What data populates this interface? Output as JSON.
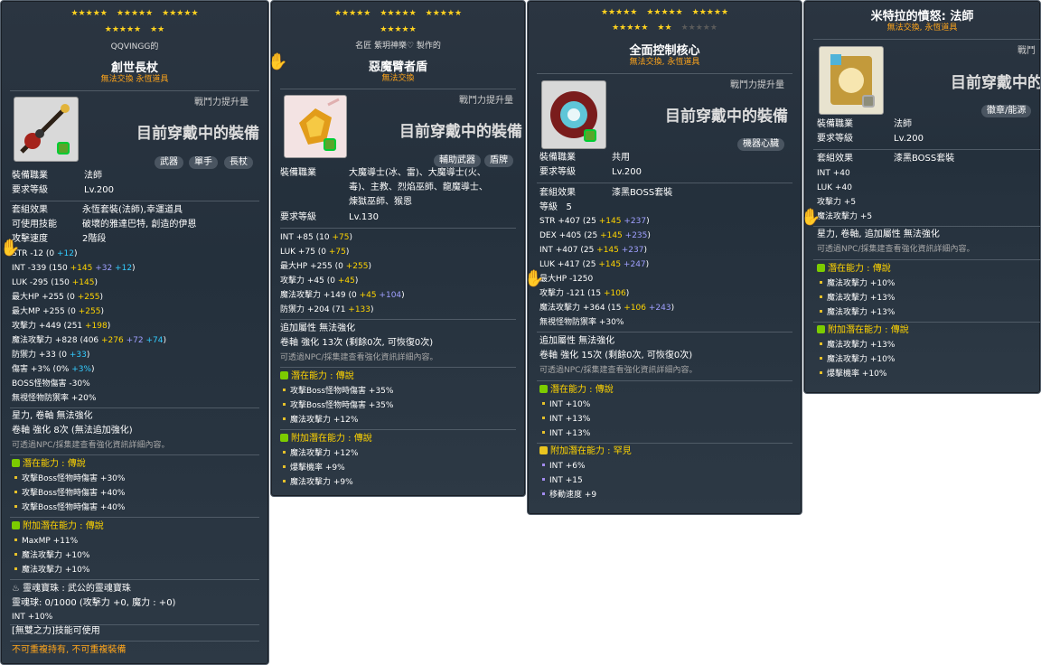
{
  "panel1": {
    "stars_row1": [
      "★★★★★",
      "★★★★★",
      "★★★★★"
    ],
    "stars_row2": [
      "★★★★★",
      "★★"
    ],
    "owner": "QQVINGG的",
    "title": "創世長杖",
    "subtitle": "無法交換  永恆道具",
    "boost_label": "戰鬥力提升量",
    "current_equipped": "目前穿戴中的裝備",
    "tags": [
      "武器",
      "單手",
      "長杖"
    ],
    "job_label": "裝備職業",
    "job_value": "法師",
    "req_level_label": "要求等級",
    "req_level_value": "Lv.200",
    "set_label": "套組效果",
    "set_value": "永恆套裝(法師),幸運道具",
    "skill_label": "可使用技能",
    "skill_value": "破壞的雅達巴特, 創造的伊恩",
    "speed_label": "攻擊速度",
    "speed_value": "2階段",
    "stats": [
      {
        "name": "STR",
        "base": " -12 (",
        "v1": "0 ",
        "v2": "+12",
        "close": ")"
      },
      {
        "name": "INT",
        "base": " -339 (150 ",
        "v1": "+145",
        "v2": " +32 ",
        "v3": "+12",
        "close": ")"
      },
      {
        "name": "LUK",
        "base": " -295 (150 ",
        "v1": "+145",
        "close": ")"
      },
      {
        "name": "最大HP",
        "base": " +255 (0 ",
        "v1": "+255",
        "close": ")"
      },
      {
        "name": "最大MP",
        "base": " +255 (0 ",
        "v1": "+255",
        "close": ")"
      },
      {
        "name": "攻擊力",
        "base": " +449 (251 ",
        "v1": "+198",
        "close": ")"
      },
      {
        "name": "魔法攻擊力",
        "base": " +828 (406 ",
        "v1": "+276",
        "v2": " +72 ",
        "v3": "+74",
        "close": ")"
      },
      {
        "name": "防禦力",
        "base": " +33 (0 ",
        "v1": "+33",
        "close": ")"
      },
      {
        "name": "傷害",
        "base": " +3% (0% ",
        "v1": "+3%",
        "close": ")"
      },
      {
        "name": "BOSS怪物傷害",
        "base": " -30%"
      },
      {
        "name": "無視怪物防禦率",
        "base": " +20%"
      }
    ],
    "star_scroll": "星力, 卷軸 無法強化",
    "upgrade": "卷軸 強化 8次 (無法追加強化)",
    "npc_note": "可透過NPC/採集建查看強化資訊詳細內容。",
    "potential_title": "潛在能力 : 傳說",
    "potential": [
      "攻擊Boss怪物時傷害 +30%",
      "攻擊Boss怪物時傷害 +40%",
      "攻擊Boss怪物時傷害 +40%"
    ],
    "add_potential_title": "附加潛在能力 : 傳說",
    "add_potential": [
      "MaxMP +11%",
      "魔法攻擊力 +10%",
      "魔法攻擊力 +10%"
    ],
    "soul_title": "靈魂寶珠 : 武公的靈魂寶珠",
    "soul_value": "靈魂球: 0/1000 (攻擊力 +0, 魔力 : +0)",
    "soul_int": "INT +10%",
    "skill_note": "[無雙之力]技能可使用",
    "bottom_note": "不可重複持有, 不可重複裝備"
  },
  "panel2": {
    "stars_row1": [
      "★★★★★",
      "★★★★★",
      "★★★★★"
    ],
    "stars_row2": [
      "★★★★★"
    ],
    "maker": "名匠 紫玥神樂♡ 製作的",
    "title": "惡魔臂者盾",
    "subtitle": "無法交換",
    "boost_label": "戰鬥力提升量",
    "current_equipped": "目前穿戴中的裝備",
    "tags": [
      "輔助武器",
      "盾牌"
    ],
    "job_label": "裝備職業",
    "job_value": [
      "大魔導士(冰、雷)、大魔導士(火、",
      "毒)、主教、烈焰巫師、龍魔導士、",
      "煉獄巫師、猴恩"
    ],
    "req_level_label": "要求等級",
    "req_level_value": "Lv.130",
    "stats": [
      {
        "name": "INT",
        "base": " +85 (10 ",
        "v1": "+75",
        "close": ")"
      },
      {
        "name": "LUK",
        "base": " +75 (0 ",
        "v1": "+75",
        "close": ")"
      },
      {
        "name": "最大HP",
        "base": " +255 (0 ",
        "v1": "+255",
        "close": ")"
      },
      {
        "name": "攻擊力",
        "base": " +45 (0 ",
        "v1": "+45",
        "close": ")"
      },
      {
        "name": "魔法攻擊力",
        "base": " +149 (0 ",
        "v1": "+45",
        "v2": " +104",
        "close": ")"
      },
      {
        "name": "防禦力",
        "base": " +204 (71 ",
        "v1": "+133",
        "close": ")"
      }
    ],
    "add_attr": "追加屬性 無法強化",
    "upgrade": "卷軸 強化 13次 (剩餘0次, 可恢復0次)",
    "npc_note": "可透過NPC/採集建查看強化資訊詳細內容。",
    "potential_title": "潛在能力 : 傳說",
    "potential": [
      "攻擊Boss怪物時傷害 +35%",
      "攻擊Boss怪物時傷害 +35%",
      "魔法攻擊力 +12%"
    ],
    "add_potential_title": "附加潛在能力 : 傳說",
    "add_potential": [
      "魔法攻擊力 +12%",
      "爆擊機率 +9%",
      "魔法攻擊力 +9%"
    ]
  },
  "panel3": {
    "stars_row1": [
      "★★★★★",
      "★★★★★",
      "★★★★★"
    ],
    "stars_row2": [
      "★★★★★",
      "★★",
      "★★★★★"
    ],
    "title": "全面控制核心",
    "subtitle": "無法交換, 永恆道具",
    "boost_label": "戰鬥力提升量",
    "current_equipped": "目前穿戴中的裝備",
    "tags": [
      "機器心臟"
    ],
    "job_label": "裝備職業",
    "job_value": "共用",
    "req_level_label": "要求等級",
    "req_level_value": "Lv.200",
    "set_label": "套組效果",
    "set_value": "漆黑BOSS套裝",
    "level_label": "等級",
    "level_value": "5",
    "stats": [
      {
        "name": "STR",
        "base": " +407 (25 ",
        "v1": "+145",
        "v2": " +237",
        "close": ")"
      },
      {
        "name": "DEX",
        "base": " +405 (25 ",
        "v1": "+145",
        "v2": " +235",
        "close": ")"
      },
      {
        "name": "INT",
        "base": " +407 (25 ",
        "v1": "+145",
        "v2": " +237",
        "close": ")"
      },
      {
        "name": "LUK",
        "base": " +417 (25 ",
        "v1": "+145",
        "v2": " +247",
        "close": ")"
      },
      {
        "name": "最大HP",
        "base": " -1250"
      },
      {
        "name": "攻擊力",
        "base": " -121 (15 ",
        "v1": "+106",
        "close": ")"
      },
      {
        "name": "魔法攻擊力",
        "base": " +364 (15 ",
        "v1": "+106",
        "v2": " +243",
        "close": ")"
      },
      {
        "name": "無視怪物防禦率",
        "base": " +30%"
      }
    ],
    "add_attr": "追加屬性 無法強化",
    "upgrade": "卷軸 強化 15次 (剩餘0次, 可恢復0次)",
    "npc_note": "可透過NPC/採集建查看強化資訊詳細內容。",
    "potential_title": "潛在能力 : 傳說",
    "potential": [
      "INT +10%",
      "INT +13%",
      "INT +13%"
    ],
    "add_potential_title": "附加潛在能力 : 罕見",
    "add_potential": [
      "INT +6%",
      "INT +15",
      "移動速度 +9"
    ]
  },
  "panel4": {
    "title": "米特拉的憤怒: 法師",
    "subtitle": "無法交換, 永恆道具",
    "boost_label": "戰鬥",
    "current_equipped": "目前穿戴中的",
    "tags": [
      "徽章/能源"
    ],
    "job_label": "裝備職業",
    "job_value": "法師",
    "req_level_label": "要求等級",
    "req_level_value": "Lv.200",
    "set_label": "套組效果",
    "set_value": "漆黑BOSS套裝",
    "stats": [
      {
        "name": "INT",
        "base": " +40"
      },
      {
        "name": "LUK",
        "base": " +40"
      },
      {
        "name": "攻擊力",
        "base": " +5"
      },
      {
        "name": "魔法攻擊力",
        "base": " +5"
      }
    ],
    "star_scroll": "星力, 卷軸, 追加屬性 無法強化",
    "npc_note": "可透過NPC/採集建查看強化資訊詳細內容。",
    "potential_title": "潛在能力 : 傳說",
    "potential": [
      "魔法攻擊力 +10%",
      "魔法攻擊力 +13%",
      "魔法攻擊力 +13%"
    ],
    "add_potential_title": "附加潛在能力 : 傳說",
    "add_potential": [
      "魔法攻擊力 +13%",
      "魔法攻擊力 +10%",
      "爆擊機率 +10%"
    ]
  }
}
